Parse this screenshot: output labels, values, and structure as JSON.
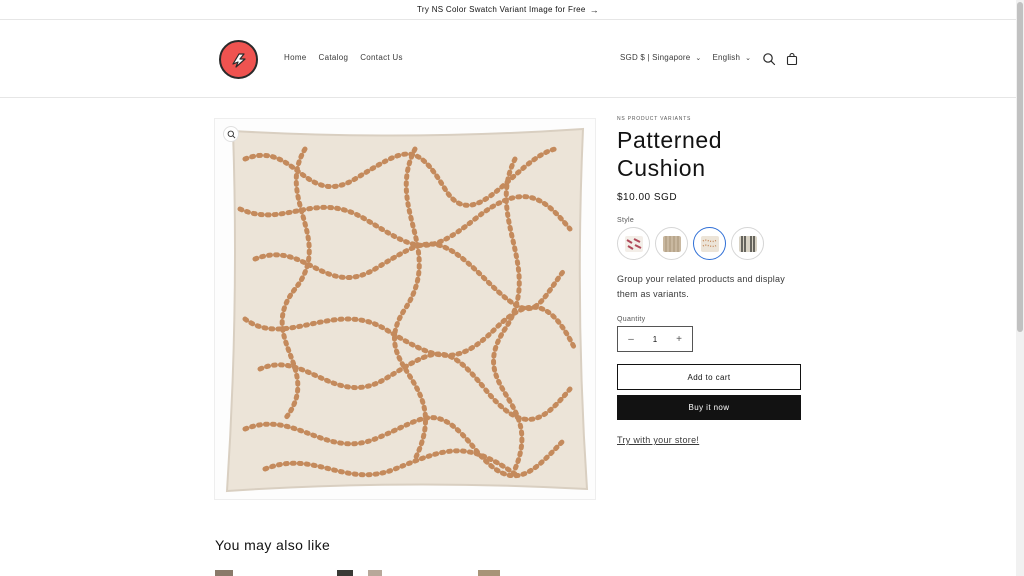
{
  "announcement": {
    "text": "Try NS Color Swatch Variant Image for Free",
    "arrow": "→"
  },
  "header": {
    "nav": [
      {
        "label": "Home"
      },
      {
        "label": "Catalog"
      },
      {
        "label": "Contact Us"
      }
    ],
    "currency": "SGD $ | Singapore",
    "language": "English",
    "icons": [
      "search-icon",
      "cart-icon"
    ]
  },
  "product": {
    "vendor": "NS PRODUCT VARIANTS",
    "title": "Patterned Cushion",
    "price": "$10.00 SGD",
    "style_label": "Style",
    "swatches": [
      "swatch-1",
      "swatch-2",
      "swatch-3",
      "swatch-4"
    ],
    "selected_swatch_index": 2,
    "description": "Group your related products and display them as variants.",
    "quantity_label": "Quantity",
    "quantity": "1",
    "add_to_cart": "Add to cart",
    "buy_now": "Buy it now",
    "try_link": "Try with your store!"
  },
  "recommendations": {
    "heading": "You may also like"
  },
  "colors": {
    "logo": "#ef5350",
    "accent": "#2f6fd6",
    "primary": "#121212",
    "cushion": "#ece4d8",
    "pattern": "#c48a5c"
  }
}
